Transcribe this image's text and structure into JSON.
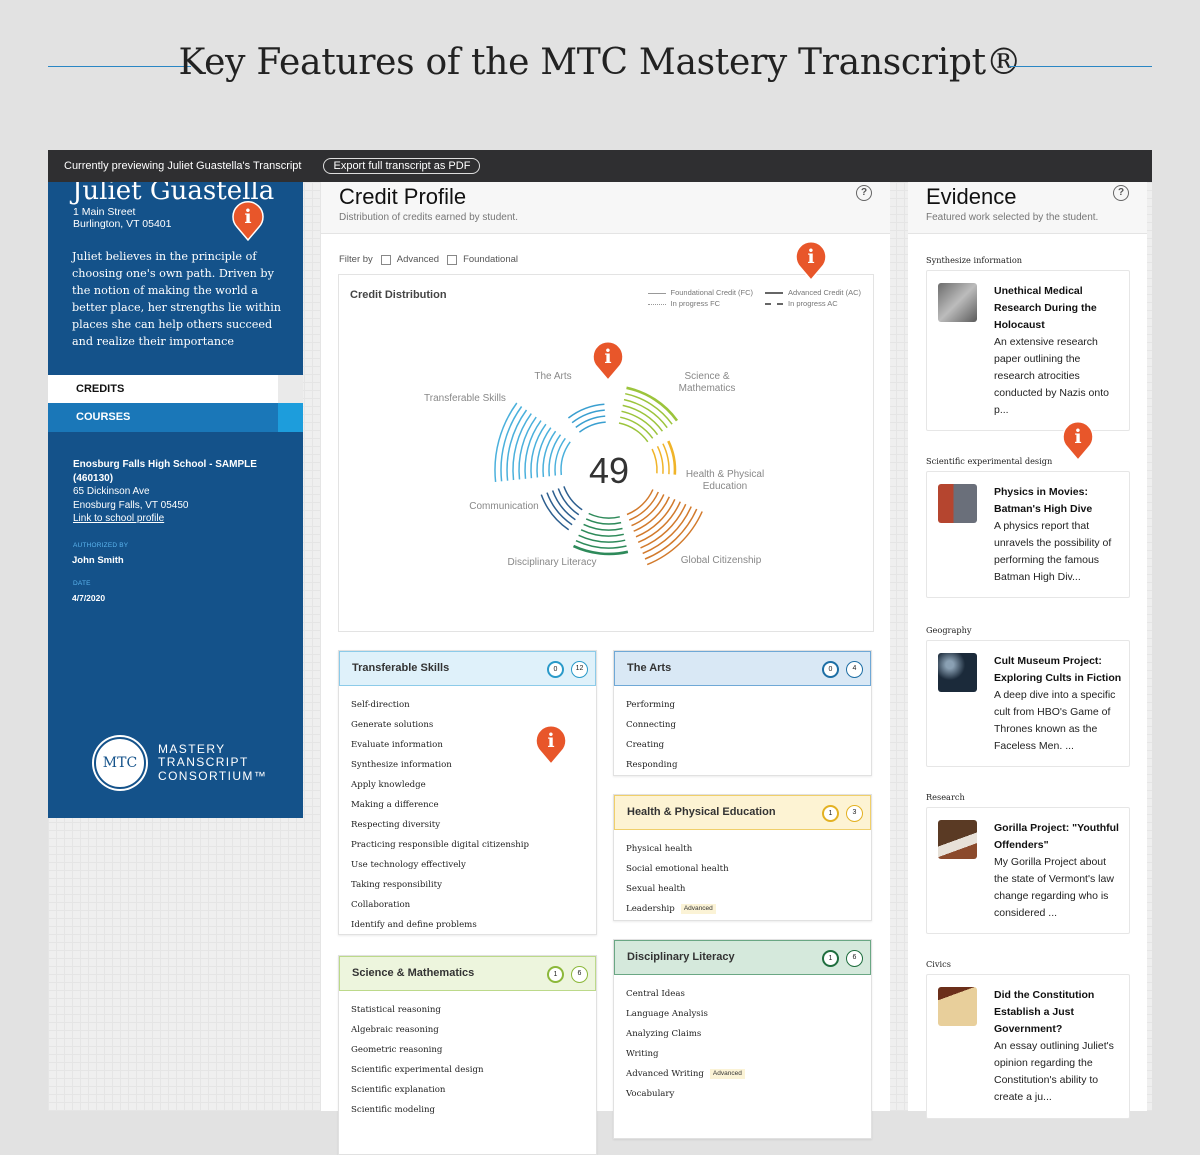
{
  "page": {
    "title": "Key Features of the MTC Mastery Transcript®"
  },
  "topbar": {
    "preview_text": "Currently previewing Juliet Guastella's Transcript",
    "export_label": "Export full transcript as PDF"
  },
  "student": {
    "name": "Juliet Guastella",
    "address_line1": "1 Main Street",
    "address_line2": "Burlington, VT 05401",
    "bio": "Juliet believes in the principle of choosing one's own path. Driven by the notion of making the world a better place, her strengths lie within places she can help others succeed and realize their importance"
  },
  "nav": {
    "credits_label": "CREDITS",
    "courses_label": "COURSES"
  },
  "school": {
    "name": "Enosburg Falls High School - SAMPLE",
    "code": "(460130)",
    "address_line1": "65 Dickinson Ave",
    "address_line2": "Enosburg Falls, VT 05450",
    "profile_link": "Link to school profile",
    "authorized_label": "AUTHORIZED BY",
    "authorized_by": "John Smith",
    "date_label": "DATE",
    "date": "4/7/2020"
  },
  "logo": {
    "initials": "MTC",
    "line1": "MASTERY",
    "line2": "TRANSCRIPT",
    "line3": "CONSORTIUM™"
  },
  "credit_profile": {
    "title": "Credit Profile",
    "subtitle": "Distribution of credits earned by student.",
    "help_icon": "?",
    "filter_label": "Filter by",
    "filter_options": [
      {
        "label": "Advanced",
        "checked": false
      },
      {
        "label": "Foundational",
        "checked": false
      }
    ]
  },
  "chart_data": {
    "type": "radial-arc",
    "title": "Credit Distribution",
    "total": "49",
    "legend": [
      {
        "label": "Foundational Credit (FC)",
        "style": "solid-thin"
      },
      {
        "label": "Advanced Credit (AC)",
        "style": "solid-thick"
      },
      {
        "label": "In progress FC",
        "style": "dotted"
      },
      {
        "label": "In progress AC",
        "style": "dashed"
      }
    ],
    "segments": [
      {
        "name": "The Arts",
        "foundational": 4,
        "advanced": 0,
        "color": "#3a9fd0"
      },
      {
        "name": "Science & Mathematics",
        "foundational": 6,
        "advanced": 1,
        "color": "#9cc43c"
      },
      {
        "name": "Health & Physical Education",
        "foundational": 3,
        "advanced": 1,
        "color": "#f0b429"
      },
      {
        "name": "Global Citizenship",
        "foundational": 10,
        "advanced": 0,
        "color": "#d27a2c"
      },
      {
        "name": "Disciplinary Literacy",
        "foundational": 6,
        "advanced": 1,
        "color": "#2e8a5a"
      },
      {
        "name": "Communication",
        "foundational": 5,
        "advanced": 0,
        "color": "#2d5f8f"
      },
      {
        "name": "Transferable Skills",
        "foundational": 12,
        "advanced": 0,
        "color": "#4ab0dc"
      }
    ]
  },
  "credit_cards": [
    {
      "title": "Transferable Skills",
      "advanced": "0",
      "total": "12",
      "head_bg": "#dff1fa",
      "head_border": "#8ccbe9",
      "badge_color": "#2a9ac9",
      "items": [
        {
          "label": "Self-direction"
        },
        {
          "label": "Generate solutions"
        },
        {
          "label": "Evaluate information"
        },
        {
          "label": "Synthesize information"
        },
        {
          "label": "Apply knowledge"
        },
        {
          "label": "Making a difference"
        },
        {
          "label": "Respecting diversity"
        },
        {
          "label": "Practicing responsible digital citizenship"
        },
        {
          "label": "Use technology effectively"
        },
        {
          "label": "Taking responsibility"
        },
        {
          "label": "Collaboration"
        },
        {
          "label": "Identify and define problems"
        }
      ]
    },
    {
      "title": "The Arts",
      "advanced": "0",
      "total": "4",
      "head_bg": "#d9e8f5",
      "head_border": "#6fa8d6",
      "badge_color": "#1e6fa5",
      "items": [
        {
          "label": "Performing"
        },
        {
          "label": "Connecting"
        },
        {
          "label": "Creating"
        },
        {
          "label": "Responding"
        }
      ]
    },
    {
      "title": "Health & Physical Education",
      "advanced": "1",
      "total": "3",
      "head_bg": "#fdf3d3",
      "head_border": "#f0cf6a",
      "badge_color": "#e3b122",
      "items": [
        {
          "label": "Physical health"
        },
        {
          "label": "Social emotional health"
        },
        {
          "label": "Sexual health"
        },
        {
          "label": "Leadership",
          "tag": "Advanced"
        }
      ]
    },
    {
      "title": "Science & Mathematics",
      "advanced": "1",
      "total": "6",
      "head_bg": "#edf5dd",
      "head_border": "#bcd98a",
      "badge_color": "#8cb83a",
      "items": [
        {
          "label": "Statistical reasoning"
        },
        {
          "label": "Algebraic reasoning"
        },
        {
          "label": "Geometric reasoning"
        },
        {
          "label": "Scientific experimental design"
        },
        {
          "label": "Scientific explanation"
        },
        {
          "label": "Scientific modeling"
        }
      ]
    },
    {
      "title": "Disciplinary Literacy",
      "advanced": "1",
      "total": "6",
      "head_bg": "#d5e9dc",
      "head_border": "#6aa784",
      "badge_color": "#1f6e3e",
      "items": [
        {
          "label": "Central Ideas"
        },
        {
          "label": "Language Analysis"
        },
        {
          "label": "Analyzing Claims"
        },
        {
          "label": "Writing"
        },
        {
          "label": "Advanced Writing",
          "tag": "Advanced"
        },
        {
          "label": "Vocabulary"
        }
      ]
    }
  ],
  "evidence": {
    "title": "Evidence",
    "subtitle": "Featured work selected by the student.",
    "help_icon": "?",
    "items": [
      {
        "section": "Synthesize information",
        "title": "Unethical Medical Research During the Holocaust",
        "description": "An extensive research paper outlining the research atrocities conducted by Nazis onto p...",
        "thumb": "fence-photo-icon"
      },
      {
        "section": "Scientific experimental design",
        "title": "Physics in Movies: Batman's High Dive",
        "description": "A physics report that unravels the possibility of performing the famous Batman High Div...",
        "thumb": "batman-photo-icon"
      },
      {
        "section": "Geography",
        "title": "Cult Museum Project: Exploring Cults in Fiction",
        "description": "A deep dive into a specific cult from HBO's Game of Thrones known as the Faceless Men. ...",
        "thumb": "faces-photo-icon"
      },
      {
        "section": "Research",
        "title": "Gorilla Project: \"Youthful Offenders\"",
        "description": "My Gorilla Project about the state of Vermont's law change regarding who is considered ...",
        "thumb": "gavel-photo-icon"
      },
      {
        "section": "Civics",
        "title": "Did the Constitution Establish a Just Government?",
        "description": "An essay outlining Juliet's opinion regarding the Constitution's ability to create a ju...",
        "thumb": "constitution-photo-icon"
      }
    ]
  },
  "info_pin": {
    "glyph": "i",
    "color": "#e8562a"
  }
}
